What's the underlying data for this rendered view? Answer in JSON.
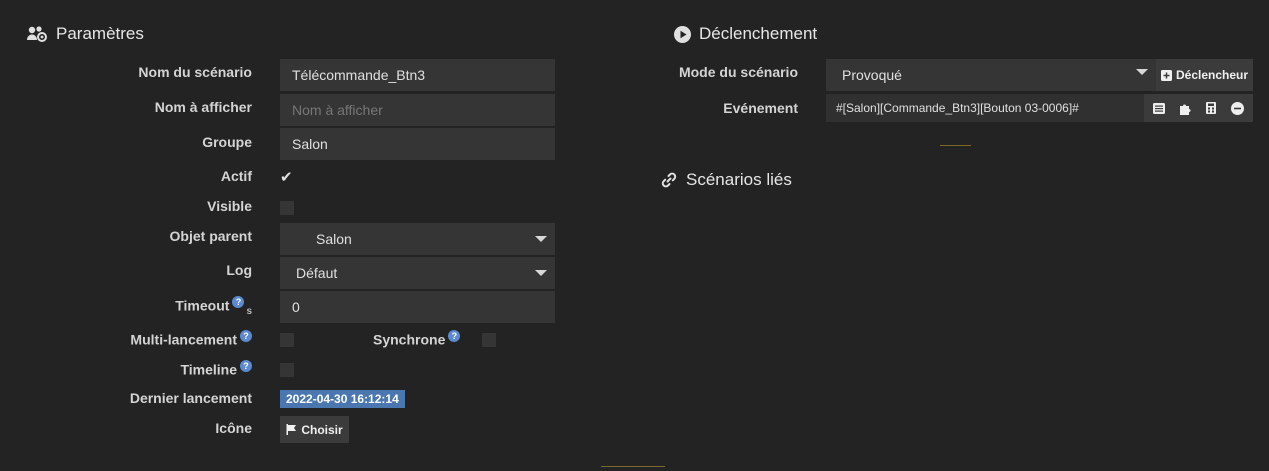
{
  "params": {
    "title": "Paramètres",
    "labels": {
      "name": "Nom du scénario",
      "display": "Nom à afficher",
      "group": "Groupe",
      "active": "Actif",
      "visible": "Visible",
      "parent": "Objet parent",
      "log": "Log",
      "timeout": "Timeout",
      "timeout_unit": "s",
      "multi": "Multi-lancement",
      "sync": "Synchrone",
      "timeline": "Timeline",
      "last": "Dernier lancement",
      "icon": "Icône"
    },
    "values": {
      "name": "Télécommande_Btn3",
      "display_placeholder": "Nom à afficher",
      "group": "Salon",
      "active": true,
      "visible": false,
      "parent": "Salon",
      "log": "Défaut",
      "timeout": "0",
      "multi": false,
      "sync": false,
      "timeline": false,
      "last": "2022-04-30 16:12:14"
    },
    "icon_button": "Choisir"
  },
  "trigger": {
    "title": "Déclenchement",
    "mode_label": "Mode du scénario",
    "mode_value": "Provoqué",
    "add_button": "Déclencheur",
    "event_label": "Evénement",
    "event_value": "#[Salon][Commande_Btn3][Bouton 03-0006]#"
  },
  "linked": {
    "title": "Scénarios liés"
  },
  "colors": {
    "background": "#232323",
    "field": "#353535",
    "badge": "#4a77b0",
    "help": "#5b8ad0"
  }
}
